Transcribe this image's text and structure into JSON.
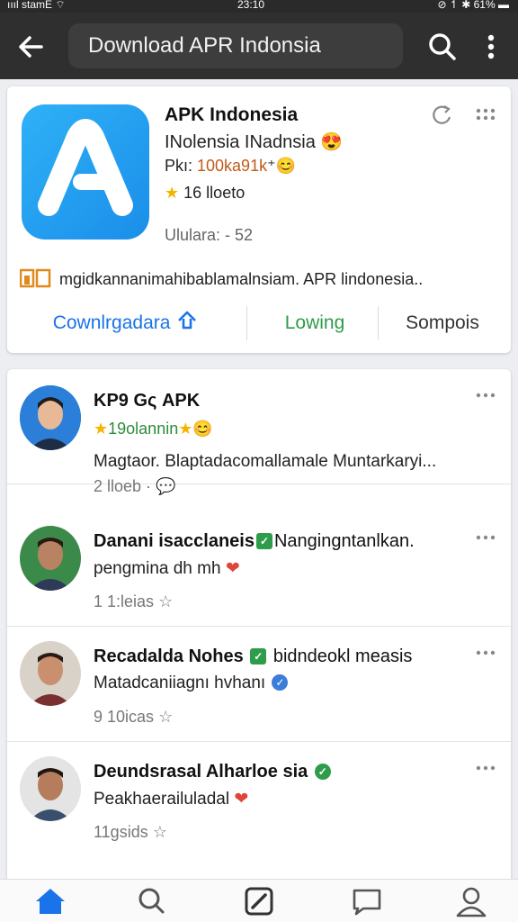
{
  "status_bar": {
    "left": "ıııl stamE ⌔",
    "time": "23:10",
    "right": "⊘ ↿ ✱ 61% ▬"
  },
  "header": {
    "search_value": "Download APR Indonsia"
  },
  "app_card": {
    "title": "APK Indonesia",
    "subtitle": "INolensia INadnsia 😍",
    "meta_label": "Pkı: ",
    "meta_value": "100ka91k",
    "meta_suffix": "⁺😊",
    "rating_text": "16 lloeto",
    "size_text": "Ululara: - 52",
    "description": "mgidkannanimahibablamalnsiam. APR lindonesia..",
    "actions": {
      "download": "Cownlrgadara",
      "follow": "Lowing",
      "similar": "Sompois"
    },
    "colors": {
      "icon_blue": "#1a8ee9",
      "download": "#1a73e8",
      "follow": "#2e9c4b"
    }
  },
  "feed": [
    {
      "name": "KP9 Gς APK",
      "rating": "19olannin",
      "text": "Magtaor. Blaptadacomallamale Muntarkaryi...",
      "meta": "2 lloeb ·"
    },
    {
      "name": "Danani isacclaneis",
      "name_rest": "Nangingntanlkan.",
      "text": "pengmina dh mh",
      "meta": "1 1:leias"
    },
    {
      "name": "Recadalda Nohes",
      "name_rest": "bidndeokl measis",
      "text": "Matadcaniiagnı hvhanı",
      "meta": "9 10icas"
    },
    {
      "name": "Deundsrasal Alharloe sia",
      "text": "Peakhaerailuladal",
      "meta": "11gsids"
    }
  ],
  "nav": {
    "items": [
      "home",
      "search",
      "compose",
      "messages",
      "profile"
    ],
    "active": "home",
    "active_color": "#1a73e8"
  }
}
